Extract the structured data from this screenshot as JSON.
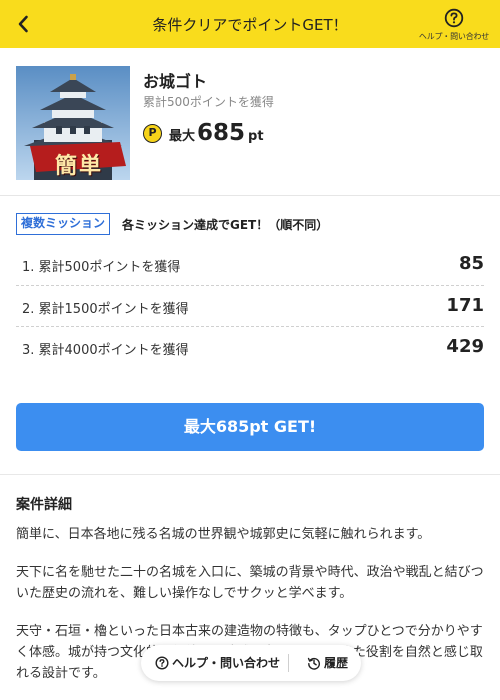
{
  "header": {
    "title": "条件クリアでポイントGET！",
    "help_label": "ヘルプ・問い合わせ"
  },
  "offer": {
    "name": "お城ゴト",
    "subtitle": "累計500ポイントを獲得",
    "coin_symbol": "P",
    "reward_prefix": "最大",
    "reward_points": "685",
    "reward_unit": "pt",
    "thumbnail_badge": "簡単"
  },
  "missions": {
    "badge": "複数ミッション",
    "note": "各ミッション達成でGET！（順不同）",
    "items": [
      {
        "label": "1. 累計500ポイントを獲得",
        "points": "85"
      },
      {
        "label": "2. 累計1500ポイントを獲得",
        "points": "171"
      },
      {
        "label": "3. 累計4000ポイントを獲得",
        "points": "429"
      }
    ]
  },
  "cta": {
    "label": "最大685pt GET!"
  },
  "details": {
    "title": "案件詳細",
    "paragraphs": [
      "簡単に、日本各地に残る名城の世界観や城郭史に気軽に触れられます。",
      "天下に名を馳せた二十の名城を入口に、築城の背景や時代、政治や戦乱と結びついた歴史の流れを、難しい操作なしでサクッと学べます。",
      "天守・石垣・櫓といった日本古来の建造物の特徴も、タップひとつで分かりやすく体感。城が持つ文化的な価値や、地域の中で果たしてきた役割を自然と感じ取れる設計です。"
    ]
  },
  "floating_bar": {
    "help_label": "ヘルプ・問い合わせ",
    "history_label": "履歴"
  },
  "colors": {
    "header_bg": "#f9dc1c",
    "accent_blue": "#3c8ef0",
    "badge_blue": "#2f6fd8",
    "coin_yellow": "#f6d31a"
  }
}
